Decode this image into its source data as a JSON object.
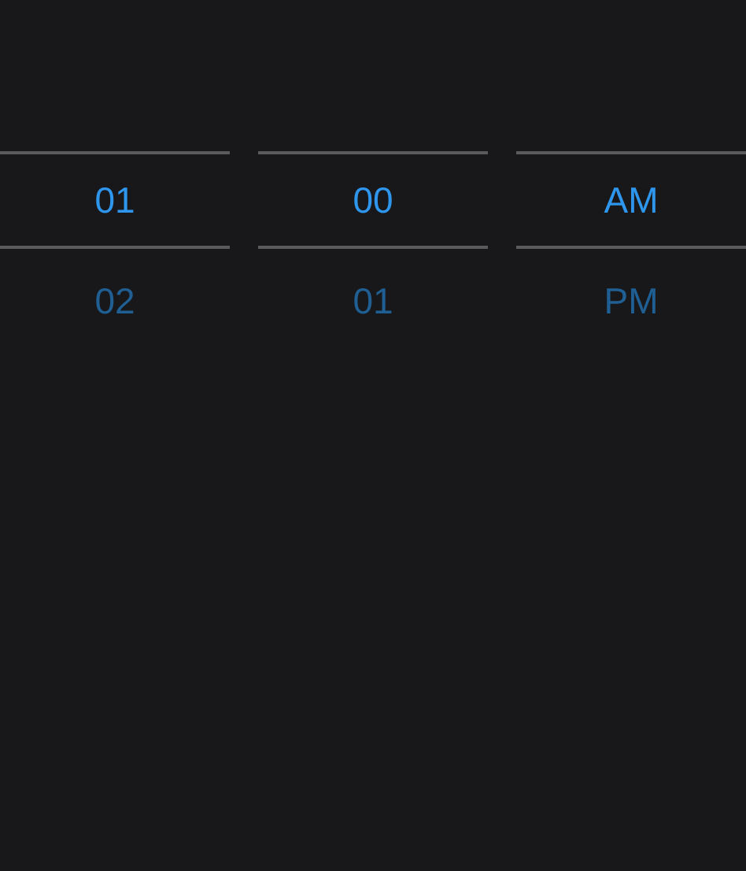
{
  "wheels": [
    {
      "items": [
        {
          "label": "01",
          "selected": true
        },
        {
          "label": "02",
          "selected": false
        }
      ]
    },
    {
      "items": [
        {
          "label": "00",
          "selected": true
        },
        {
          "label": "01",
          "selected": false
        }
      ]
    },
    {
      "items": [
        {
          "label": "AM",
          "selected": true
        },
        {
          "label": "PM",
          "selected": false
        }
      ]
    }
  ]
}
